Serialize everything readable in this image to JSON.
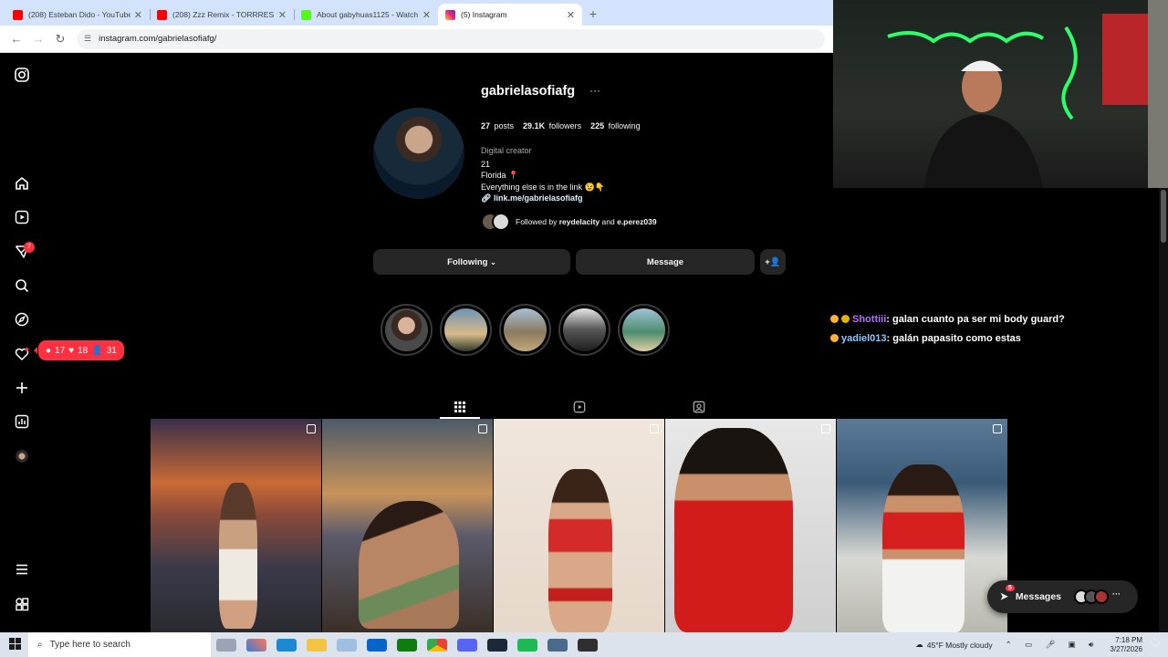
{
  "tabs": [
    {
      "title": "(208) Esteban Dido - YouTube",
      "color": "#ff0000"
    },
    {
      "title": "(208) Zzz Remix - TORRRES x El...",
      "color": "#ff0000"
    },
    {
      "title": "About gabyhuas1125 - Watch L...",
      "color": "#53fc18"
    },
    {
      "title": "(5) Instagram",
      "color": "#d6249f"
    }
  ],
  "address": "instagram.com/gabrielasofiafg/",
  "notifications": {
    "comments": "17",
    "likes": "18",
    "follows": "31",
    "explore_badge": "7"
  },
  "profile": {
    "username": "gabrielasofiafg",
    "posts": "27",
    "posts_label": "posts",
    "followers": "29.1K",
    "followers_label": "followers",
    "following": "225",
    "following_label": "following",
    "category": "Digital creator",
    "bio_line1": "21",
    "bio_line2": "Florida 📍",
    "bio_line3": "Everything else is in the link 😉👇",
    "link": "link.me/gabrielasofiafg",
    "followed_prefix": "Followed by",
    "followed_user1": "reydelacity",
    "followed_and": "and",
    "followed_user2": "e.perez039",
    "following_button": "Following",
    "message_button": "Message"
  },
  "chat": [
    {
      "user": "Shottiii",
      "text": ": galan cuanto pa ser mi body guard?"
    },
    {
      "user": "yadiel013",
      "text": ": galán papasito como estas"
    }
  ],
  "messages": {
    "label": "Messages",
    "badge": "5"
  },
  "taskbar": {
    "search_placeholder": "Type here to search",
    "weather": "45°F  Mostly cloudy",
    "time": "7:18 PM",
    "date": "3/27/2026"
  }
}
